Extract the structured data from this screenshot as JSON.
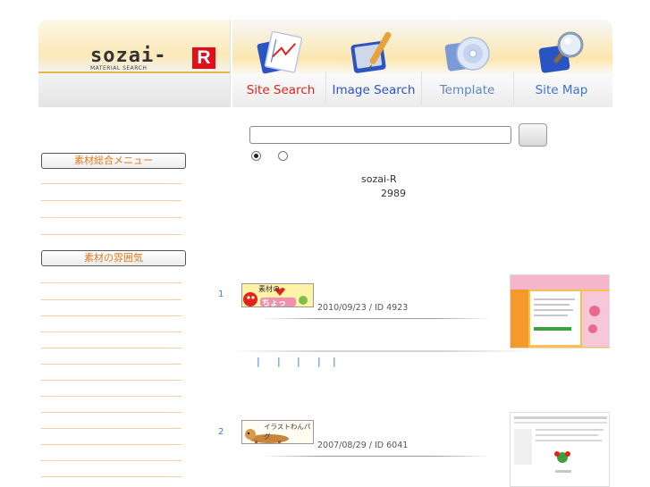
{
  "header": {
    "logo_text": "sozai-",
    "logo_sub": "MATERIAL SEARCH",
    "logo_mark": "R",
    "nav": [
      {
        "label": "Site Search",
        "color": "#e3231a",
        "icon": "site-search-icon"
      },
      {
        "label": "Image Search",
        "color": "#2c53c8",
        "icon": "image-search-icon"
      },
      {
        "label": "Template",
        "color": "#5c86c8",
        "icon": "template-cd-icon"
      },
      {
        "label": "Site Map",
        "color": "#3c74d0",
        "icon": "site-map-magnifier-icon"
      }
    ]
  },
  "sidebar": {
    "menu1_title": "素材総合メニュー",
    "menu2_title": "素材の雰囲気"
  },
  "search": {
    "query": "",
    "radio_selected": 0
  },
  "site": {
    "name": "sozai-R",
    "count": "2989"
  },
  "results": [
    {
      "rank": "1",
      "banner_text": "素材の",
      "banner_text2": "ちょっ",
      "meta": "2010/09/23 / ID 4923"
    },
    {
      "rank": "2",
      "banner_text": "イラストわんパグ",
      "meta": "2007/08/29 / ID 6041"
    }
  ],
  "pager": [
    "|",
    "|",
    "|",
    "|",
    "|"
  ],
  "colors": {
    "accent": "#e07a1a",
    "link": "#3b7fd0",
    "logo_red": "#e20f1a"
  }
}
